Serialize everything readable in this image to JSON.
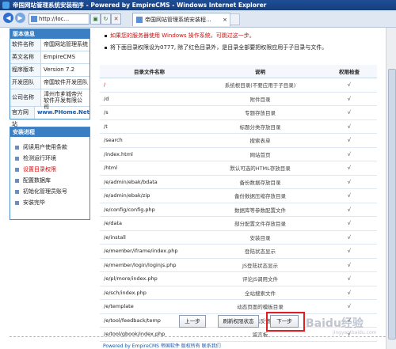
{
  "window": {
    "title": "帝国网站管理系统安装程序 - Powered by EmpireCMS - Windows Internet Explorer"
  },
  "browser": {
    "address": "http://loc...",
    "tab_title": "帝国网站管理系统安装程...",
    "tab_close": "×"
  },
  "sidebar": {
    "info_title": "版本信息",
    "info": [
      {
        "key": "软件名称",
        "value": "帝国网站管理系统"
      },
      {
        "key": "英文名称",
        "value": "EmpireCMS"
      },
      {
        "key": "程序版本",
        "value": "Version 7.2"
      },
      {
        "key": "开发团队",
        "value": "帝国软件开发团队"
      },
      {
        "key": "公司名称",
        "value": "漳州市芗城帝兴软件开发有限公司"
      },
      {
        "key": "官方网站",
        "value": "www.PHome.Net"
      }
    ],
    "steps_title": "安装进程",
    "steps": [
      "阅读用户使用条款",
      "检测运行环境",
      "设置目录权限",
      "配置数据库",
      "初始化管理员账号",
      "安装完毕"
    ]
  },
  "notes": {
    "note1": "如果您的服务器使用 Windows 操作系统，可跳过这一步。",
    "note2": "将下面目录权限设为0777, 除了红色目录外，是目录全部要把权限应用于子目录与文件。"
  },
  "table": {
    "headers": [
      "目录文件名称",
      "说明",
      "权限检查"
    ],
    "rows": [
      {
        "path": "/",
        "desc": "系统根目录(不要应用于子目录)",
        "check": "√",
        "red": true
      },
      {
        "path": "/d",
        "desc": "附件目录",
        "check": "√"
      },
      {
        "path": "/s",
        "desc": "专题存放目录",
        "check": "√"
      },
      {
        "path": "/t",
        "desc": "标题分类存放目录",
        "check": "√"
      },
      {
        "path": "/search",
        "desc": "搜索表单",
        "check": "√"
      },
      {
        "path": "/index.html",
        "desc": "网站首页",
        "check": "√"
      },
      {
        "path": "/html",
        "desc": "默认可选的HTML存放目录",
        "check": "√"
      },
      {
        "path": "/e/admin/ebak/bdata",
        "desc": "备份数据存放目录",
        "check": "√"
      },
      {
        "path": "/e/admin/ebak/zip",
        "desc": "备份数据压缩存放目录",
        "check": "√"
      },
      {
        "path": "/e/config/config.php",
        "desc": "数据库等参数配置文件",
        "check": "√"
      },
      {
        "path": "/e/data",
        "desc": "部分配置文件存放目录",
        "check": "√"
      },
      {
        "path": "/e/install",
        "desc": "安装目录",
        "check": "√"
      },
      {
        "path": "/e/member/iframe/index.php",
        "desc": "登陆状态显示",
        "check": "√"
      },
      {
        "path": "/e/member/login/loginjs.php",
        "desc": "JS登陆状态显示",
        "check": "√"
      },
      {
        "path": "/e/pl/more/index.php",
        "desc": "评论JS调用文件",
        "check": "√"
      },
      {
        "path": "/e/sch/index.php",
        "desc": "全站搜索文件",
        "check": "√"
      },
      {
        "path": "/e/template",
        "desc": "动态页面的模板目录",
        "check": "√"
      },
      {
        "path": "/e/tool/feedback/temp",
        "desc": "信息反馈",
        "check": "√"
      },
      {
        "path": "/e/tool/gbook/index.php",
        "desc": "留言板",
        "check": "√"
      }
    ]
  },
  "buttons": {
    "prev": "上一步",
    "refresh": "刷新权限状态",
    "next": "下一步"
  },
  "footer": "Powered by EmpireCMS  帝国软件  版权所有  联系我们",
  "watermark": {
    "main": "Baidu经验",
    "sub": "jingyan.baidu.com"
  }
}
